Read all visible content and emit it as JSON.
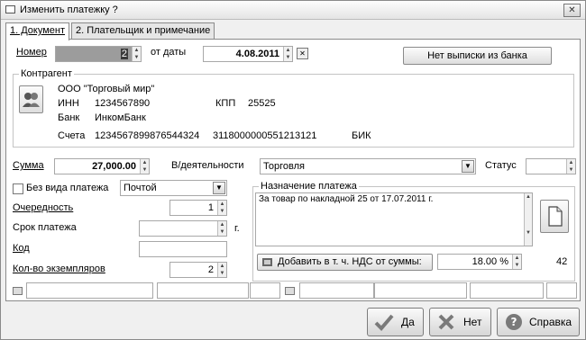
{
  "window": {
    "title": "Изменить платежку ?",
    "close_glyph": "✕"
  },
  "tabs": [
    {
      "label": "1. Документ"
    },
    {
      "label": "2. Плательщик и примечание"
    }
  ],
  "doc": {
    "number_label": "Номер",
    "number_value": "2",
    "date_label": "от даты",
    "date_value": "4.08.2011",
    "no_statement_label": "Нет выписки из банка"
  },
  "counterparty": {
    "group_label": "Контрагент",
    "name": "ООО \"Торговый мир\"",
    "inn_label": "ИНН",
    "inn_value": "1234567890",
    "kpp_label": "КПП",
    "kpp_value": "25525",
    "bank_label": "Банк",
    "bank_value": "ИнкомБанк",
    "accounts_label": "Счета",
    "account_value": "1234567899876544324",
    "corr_account_value": "3118000000551213121",
    "bik_label": "БИК"
  },
  "payment": {
    "sum_label": "Сумма",
    "sum_value": "27,000.00",
    "activity_label": "В/деятельности",
    "activity_value": "Торговля",
    "status_label": "Статус",
    "status_value": "",
    "no_type_label": "Без вида платежа",
    "no_type_checked": false,
    "method_value": "Почтой",
    "priority_label": "Очередность",
    "priority_value": "1",
    "term_label": "Срок платежа",
    "term_value": "",
    "term_suffix": "г.",
    "code_label": "Код",
    "code_value": "",
    "copies_label": "Кол-во экземпляров",
    "copies_value": "2"
  },
  "purpose": {
    "group_label": "Назначение платежа",
    "text": "За товар по накладной 25 от 17.07.2011 г.",
    "vat_button_label": "Добавить в т. ч. НДС от суммы:",
    "vat_rate": "18.00 %",
    "char_count": "42"
  },
  "footer": {
    "ok_label": "Да",
    "no_label": "Нет",
    "help_label": "Справка"
  },
  "icons": {
    "window": "window-icon",
    "calendar": "calendar-icon",
    "contact": "contacts-icon",
    "document": "document-icon",
    "vat": "add-vat-icon",
    "ok": "checkmark-icon",
    "no": "cross-icon",
    "help": "help-icon"
  }
}
